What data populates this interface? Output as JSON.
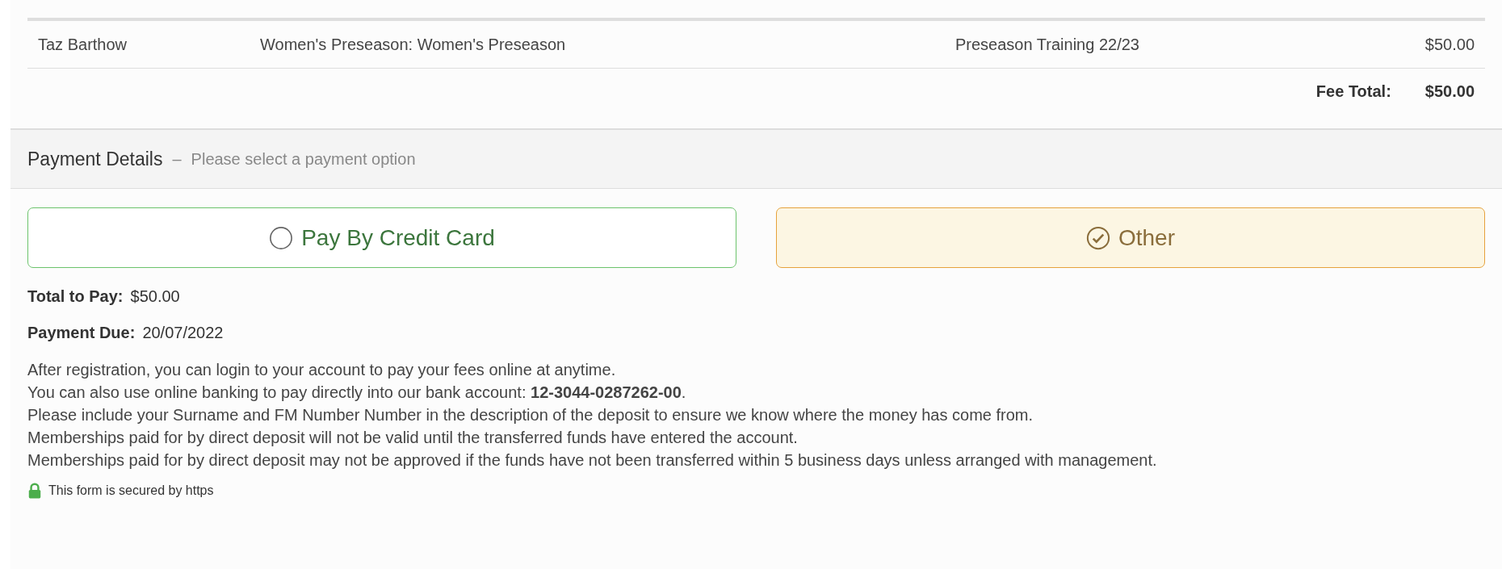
{
  "fees_table": {
    "rows": [
      {
        "name": "Taz Barthow",
        "description": "Women's Preseason: Women's Preseason",
        "item": "Preseason Training 22/23",
        "amount": "$50.00"
      }
    ],
    "total_label": "Fee Total:",
    "total_value": "$50.00"
  },
  "payment": {
    "title": "Payment Details",
    "separator": "–",
    "subtitle": "Please select a payment option",
    "options": [
      {
        "label": "Pay By Credit Card",
        "selected": false
      },
      {
        "label": "Other",
        "selected": true
      }
    ],
    "summary": [
      {
        "label": "Total to Pay:",
        "value": "$50.00"
      },
      {
        "label": "Payment Due:",
        "value": "20/07/2022"
      }
    ],
    "instructions": [
      "After registration, you can login to your account to pay your fees online at anytime.",
      "You can also use online banking to pay directly into our bank account: **12-3044-0287262-00**.",
      "Please include your Surname and FM Number Number in the description of the deposit to ensure we know where the money has come from.",
      "Memberships paid for by direct deposit will not be valid until the transferred funds have entered the account.",
      "Memberships paid for by direct deposit may not be approved if the funds have not been transferred within 5 business days unless arranged with management."
    ],
    "security_note": "This form is secured by https"
  }
}
